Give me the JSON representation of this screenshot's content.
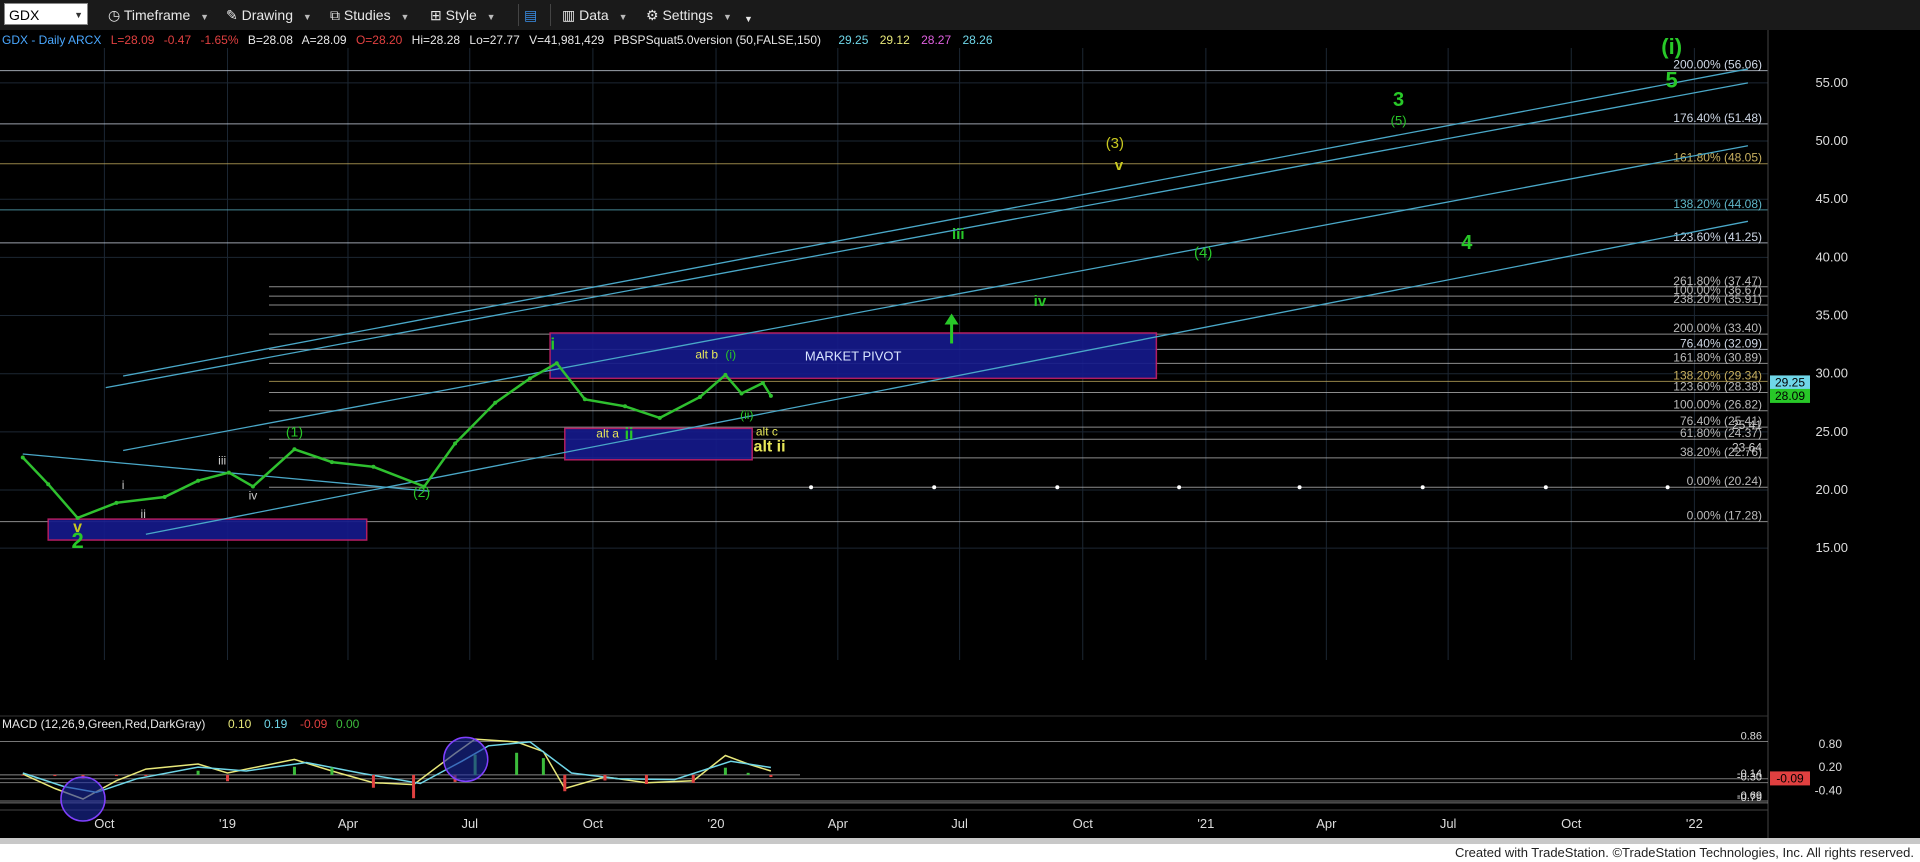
{
  "toolbar": {
    "symbol": "GDX",
    "timeframe": "Timeframe",
    "drawing": "Drawing",
    "studies": "Studies",
    "style": "Style",
    "data": "Data",
    "settings": "Settings"
  },
  "header": {
    "symbol_info": "GDX - Daily  ARCX",
    "last": "L=28.09",
    "change": "-0.47",
    "change_pct": "-1.65%",
    "bid": "B=28.08",
    "ask": "A=28.09",
    "open": "O=28.20",
    "hi": "Hi=28.28",
    "lo": "Lo=27.77",
    "volume": "V=41,981,429",
    "study": "PBSPSquat5.0version (50,FALSE,150)",
    "study_values": [
      {
        "text": "29.25",
        "color": "#6fd6e8"
      },
      {
        "text": "29.12",
        "color": "#e8e87a"
      },
      {
        "text": "28.27",
        "color": "#e060e0"
      },
      {
        "text": "28.26",
        "color": "#6fd6e8"
      }
    ]
  },
  "chart_data": {
    "type": "line",
    "title": "GDX - Daily",
    "x_tick_labels": [
      "Oct",
      "'19",
      "Apr",
      "Jul",
      "Oct",
      "'20",
      "Apr",
      "Jul",
      "Oct",
      "'21",
      "Apr",
      "Jul",
      "Oct",
      "'22"
    ],
    "y_tick_labels": [
      "55.00",
      "50.00",
      "45.00",
      "40.00",
      "35.00",
      "30.00",
      "25.00",
      "20.00",
      "15.00"
    ],
    "ylim": [
      14.5,
      58
    ],
    "last_price_tags": [
      {
        "text": "29.25",
        "value": 29.25,
        "color": "#6fd6e8"
      },
      {
        "text": "28.09",
        "value": 28.09,
        "color": "#28c828"
      }
    ],
    "price_series": [
      {
        "date": "2018-08-01",
        "close": 22.8
      },
      {
        "date": "2018-08-20",
        "close": 20.5
      },
      {
        "date": "2018-09-11",
        "close": 17.6
      },
      {
        "date": "2018-10-10",
        "close": 18.9
      },
      {
        "date": "2018-11-15",
        "close": 19.4
      },
      {
        "date": "2018-12-10",
        "close": 20.8
      },
      {
        "date": "2019-01-02",
        "close": 21.5
      },
      {
        "date": "2019-01-20",
        "close": 20.3
      },
      {
        "date": "2019-02-20",
        "close": 23.5
      },
      {
        "date": "2019-03-20",
        "close": 22.4
      },
      {
        "date": "2019-04-20",
        "close": 22.0
      },
      {
        "date": "2019-05-28",
        "close": 20.3
      },
      {
        "date": "2019-06-20",
        "close": 24.0
      },
      {
        "date": "2019-07-20",
        "close": 27.5
      },
      {
        "date": "2019-08-15",
        "close": 29.6
      },
      {
        "date": "2019-09-04",
        "close": 30.9
      },
      {
        "date": "2019-09-25",
        "close": 27.8
      },
      {
        "date": "2019-10-25",
        "close": 27.2
      },
      {
        "date": "2019-11-20",
        "close": 26.2
      },
      {
        "date": "2019-12-20",
        "close": 28.0
      },
      {
        "date": "2020-01-08",
        "close": 29.9
      },
      {
        "date": "2020-01-20",
        "close": 28.3
      },
      {
        "date": "2020-02-05",
        "close": 29.2
      },
      {
        "date": "2020-02-11",
        "close": 28.09
      }
    ],
    "fib_levels": [
      {
        "text": "200.00% (56.06)",
        "value": 56.06,
        "color": "#cfd8e6"
      },
      {
        "text": "176.40% (51.48)",
        "value": 51.48,
        "color": "#cfd8e6"
      },
      {
        "text": "161.80% (48.05)",
        "value": 48.05,
        "color": "#c8b060"
      },
      {
        "text": "138.20% (44.08)",
        "value": 44.08,
        "color": "#5fb7c8"
      },
      {
        "text": "123.60% (41.25)",
        "value": 41.25,
        "color": "#cfd8e6"
      },
      {
        "text": "261.80% (37.47)",
        "value": 37.47,
        "color": "#bbbbbb"
      },
      {
        "text": "100.00% (36.67)",
        "value": 36.67,
        "color": "#bbbbbb"
      },
      {
        "text": "238.20% (35.91)",
        "value": 35.91,
        "color": "#bbbbbb"
      },
      {
        "text": "200.00% (33.40)",
        "value": 33.4,
        "color": "#bbbbbb"
      },
      {
        "text": "76.40% (32.09)",
        "value": 32.09,
        "color": "#cfd8e6"
      },
      {
        "text": "161.80% (30.89)",
        "value": 30.89,
        "color": "#bbbbbb"
      },
      {
        "text": "138.20% (29.34)",
        "value": 29.34,
        "color": "#c8b060"
      },
      {
        "text": "123.60% (28.38)",
        "value": 28.38,
        "color": "#bbbbbb"
      },
      {
        "text": "100.00% (26.82)",
        "value": 26.82,
        "color": "#bbbbbb"
      },
      {
        "text": "76.40% (25.41)",
        "value": 25.41,
        "color": "#bbbbbb"
      },
      {
        "text": "61.80% (24.37)",
        "value": 24.37,
        "color": "#bbbbbb"
      },
      {
        "text": "38.20% (22.76)",
        "value": 22.76,
        "color": "#bbbbbb"
      },
      {
        "text": "0.00% (20.24)",
        "value": 20.24,
        "color": "#bbbbbb"
      },
      {
        "text": "0.00% (17.28)",
        "value": 17.28,
        "color": "#bbbbbb"
      }
    ],
    "extra_levels": [
      {
        "text": "25.41",
        "value": 25.6
      },
      {
        "text": "23.64",
        "value": 23.64
      }
    ],
    "zones": [
      {
        "label": "MARKET PIVOT",
        "start": "2019-08-30",
        "end": "2020-11-25",
        "low": 29.6,
        "high": 33.5
      },
      {
        "label": "",
        "start": "2019-09-10",
        "end": "2020-01-28",
        "low": 22.6,
        "high": 25.3
      },
      {
        "label": "",
        "start": "2018-08-20",
        "end": "2019-04-15",
        "low": 15.7,
        "high": 17.5
      }
    ],
    "wave_labels": [
      {
        "text": "(i)",
        "date": "2021-12-15",
        "value": 57.5,
        "color": "#28c828",
        "size": 22,
        "bold": true
      },
      {
        "text": "5",
        "date": "2021-12-15",
        "value": 54.6,
        "color": "#28c828",
        "size": 22,
        "bold": true
      },
      {
        "text": "3",
        "date": "2021-05-25",
        "value": 53.0,
        "color": "#28c828",
        "size": 20,
        "bold": true
      },
      {
        "text": "(5)",
        "date": "2021-05-25",
        "value": 51.4,
        "color": "#28c828",
        "size": 13,
        "bold": false
      },
      {
        "text": "(3)",
        "date": "2020-10-25",
        "value": 49.4,
        "color": "#c8c820",
        "size": 15,
        "bold": false
      },
      {
        "text": "v",
        "date": "2020-10-28",
        "value": 47.5,
        "color": "#c8c820",
        "size": 15,
        "bold": true
      },
      {
        "text": "iii",
        "date": "2020-06-30",
        "value": 41.6,
        "color": "#28c828",
        "size": 15,
        "bold": true
      },
      {
        "text": "(4)",
        "date": "2020-12-30",
        "value": 40.0,
        "color": "#28c828",
        "size": 15,
        "bold": false
      },
      {
        "text": "4",
        "date": "2021-07-15",
        "value": 40.7,
        "color": "#28c828",
        "size": 20,
        "bold": true
      },
      {
        "text": "iv",
        "date": "2020-08-30",
        "value": 35.8,
        "color": "#28c828",
        "size": 15,
        "bold": true
      },
      {
        "text": "i",
        "date": "2019-09-01",
        "value": 32.1,
        "color": "#28c828",
        "size": 17,
        "bold": true
      },
      {
        "text": "alt b",
        "date": "2019-12-25",
        "value": 31.3,
        "color": "#e8e85a",
        "size": 12,
        "bold": false
      },
      {
        "text": "(i)",
        "date": "2020-01-12",
        "value": 31.3,
        "color": "#28c828",
        "size": 12,
        "bold": false
      },
      {
        "text": "(ii)",
        "date": "2020-01-24",
        "value": 26.1,
        "color": "#28c828",
        "size": 12,
        "bold": false
      },
      {
        "text": "alt a",
        "date": "2019-10-12",
        "value": 24.5,
        "color": "#e8e85a",
        "size": 12,
        "bold": false
      },
      {
        "text": "ii",
        "date": "2019-10-28",
        "value": 24.4,
        "color": "#28c828",
        "size": 16,
        "bold": true
      },
      {
        "text": "alt c",
        "date": "2020-02-08",
        "value": 24.7,
        "color": "#e8e85a",
        "size": 12,
        "bold": false
      },
      {
        "text": "alt ii",
        "date": "2020-02-10",
        "value": 23.3,
        "color": "#e8e85a",
        "size": 16,
        "bold": true
      },
      {
        "text": "(1)",
        "date": "2019-02-20",
        "value": 24.6,
        "color": "#28c828",
        "size": 14,
        "bold": false
      },
      {
        "text": "(2)",
        "date": "2019-05-26",
        "value": 19.4,
        "color": "#28c828",
        "size": 14,
        "bold": false
      },
      {
        "text": "iii",
        "date": "2018-12-28",
        "value": 22.2,
        "color": "#cccccc",
        "size": 12,
        "bold": false
      },
      {
        "text": "i",
        "date": "2018-10-15",
        "value": 20.1,
        "color": "#cccccc",
        "size": 12,
        "bold": false
      },
      {
        "text": "iv",
        "date": "2019-01-20",
        "value": 19.2,
        "color": "#cccccc",
        "size": 12,
        "bold": false
      },
      {
        "text": "ii",
        "date": "2018-10-30",
        "value": 17.6,
        "color": "#cccccc",
        "size": 12,
        "bold": false
      },
      {
        "text": "v",
        "date": "2018-09-11",
        "value": 16.4,
        "color": "#c8c820",
        "size": 16,
        "bold": true
      },
      {
        "text": "2",
        "date": "2018-09-11",
        "value": 15.0,
        "color": "#28c828",
        "size": 22,
        "bold": true
      }
    ],
    "up_arrow": {
      "date": "2020-06-25",
      "from": 32.6,
      "to": 35.0,
      "color": "#28c828"
    },
    "channel_lines": [
      {
        "d1": "2018-10-15",
        "v1": 29.8,
        "d2": "2022-02-10",
        "v2": 56.2
      },
      {
        "d1": "2018-10-02",
        "v1": 28.8,
        "d2": "2022-02-10",
        "v2": 55.0
      },
      {
        "d1": "2018-10-15",
        "v1": 23.4,
        "d2": "2022-02-10",
        "v2": 49.6
      },
      {
        "d1": "2018-11-01",
        "v1": 16.2,
        "d2": "2022-02-10",
        "v2": 43.1
      },
      {
        "d1": "2018-08-01",
        "v1": 23.1,
        "d2": "2019-06-01",
        "v2": 19.9
      }
    ],
    "white_dots": [
      {
        "date": "2020-03-12",
        "value": 20.24
      },
      {
        "date": "2020-06-12",
        "value": 20.24
      },
      {
        "date": "2020-09-12",
        "value": 20.24
      },
      {
        "date": "2020-12-12",
        "value": 20.24
      },
      {
        "date": "2021-03-12",
        "value": 20.24
      },
      {
        "date": "2021-06-12",
        "value": 20.24
      },
      {
        "date": "2021-09-12",
        "value": 20.24
      },
      {
        "date": "2021-12-12",
        "value": 20.24
      }
    ],
    "macd": {
      "title": "MACD (12,26,9,Green,Red,DarkGray)",
      "values": [
        {
          "text": "0.10",
          "color": "#e8e87a"
        },
        {
          "text": "0.19",
          "color": "#6fd6e8"
        },
        {
          "text": "-0.09",
          "color": "#e04040"
        },
        {
          "text": "0.00",
          "color": "#3cbc3c"
        }
      ],
      "ylim": [
        -0.8,
        0.95
      ],
      "y_tick_labels": [
        "0.80",
        "0.20",
        "-0.40"
      ],
      "levels": [
        {
          "text": "0.86",
          "value": 0.86
        },
        {
          "text": "-0.14",
          "value": -0.1
        },
        {
          "text": "-0.30",
          "value": -0.2
        },
        {
          "text": "-0.69",
          "value": -0.67
        },
        {
          "text": "-0.79",
          "value": -0.72
        }
      ],
      "last_tag": {
        "text": "-0.09",
        "value": -0.09,
        "color": "#e04040"
      },
      "macd_series": [
        {
          "date": "2018-08-01",
          "value": 0.02
        },
        {
          "date": "2018-08-25",
          "value": -0.35
        },
        {
          "date": "2018-09-15",
          "value": -0.62
        },
        {
          "date": "2018-10-10",
          "value": -0.15
        },
        {
          "date": "2018-11-01",
          "value": 0.15
        },
        {
          "date": "2018-12-10",
          "value": 0.28
        },
        {
          "date": "2019-01-01",
          "value": 0.05
        },
        {
          "date": "2019-02-20",
          "value": 0.4
        },
        {
          "date": "2019-03-20",
          "value": 0.1
        },
        {
          "date": "2019-04-20",
          "value": -0.2
        },
        {
          "date": "2019-05-20",
          "value": -0.25
        },
        {
          "date": "2019-06-20",
          "value": 0.55
        },
        {
          "date": "2019-07-05",
          "value": 0.92
        },
        {
          "date": "2019-08-05",
          "value": 0.85
        },
        {
          "date": "2019-08-25",
          "value": 0.6
        },
        {
          "date": "2019-09-10",
          "value": -0.35
        },
        {
          "date": "2019-10-10",
          "value": -0.05
        },
        {
          "date": "2019-11-10",
          "value": -0.2
        },
        {
          "date": "2019-12-15",
          "value": -0.15
        },
        {
          "date": "2020-01-08",
          "value": 0.5
        },
        {
          "date": "2020-01-25",
          "value": 0.28
        },
        {
          "date": "2020-02-11",
          "value": 0.1
        }
      ],
      "signal_series": [
        {
          "date": "2018-08-01",
          "value": 0.05
        },
        {
          "date": "2018-09-01",
          "value": -0.3
        },
        {
          "date": "2018-09-25",
          "value": -0.45
        },
        {
          "date": "2018-10-25",
          "value": -0.1
        },
        {
          "date": "2018-12-10",
          "value": 0.2
        },
        {
          "date": "2019-01-15",
          "value": 0.1
        },
        {
          "date": "2019-03-01",
          "value": 0.32
        },
        {
          "date": "2019-04-10",
          "value": 0.05
        },
        {
          "date": "2019-05-25",
          "value": -0.22
        },
        {
          "date": "2019-06-25",
          "value": 0.35
        },
        {
          "date": "2019-07-15",
          "value": 0.75
        },
        {
          "date": "2019-08-15",
          "value": 0.85
        },
        {
          "date": "2019-09-15",
          "value": 0.05
        },
        {
          "date": "2019-10-20",
          "value": -0.1
        },
        {
          "date": "2019-12-01",
          "value": -0.12
        },
        {
          "date": "2020-01-12",
          "value": 0.35
        },
        {
          "date": "2020-02-11",
          "value": 0.19
        }
      ],
      "highlights": [
        {
          "date": "2018-09-15",
          "value": -0.62
        },
        {
          "date": "2019-06-28",
          "value": 0.4
        }
      ]
    }
  },
  "colors": {
    "background": "#000000",
    "grid": "#1c2733",
    "price_bars": "#2fc02f",
    "accent": "#28c828",
    "zone_fill": "#151a8a",
    "zone_border": "#c0206a",
    "channel": "#4aa8c8"
  },
  "footer": {
    "credit": "Created with TradeStation. ©TradeStation Technologies, Inc. All rights reserved."
  }
}
